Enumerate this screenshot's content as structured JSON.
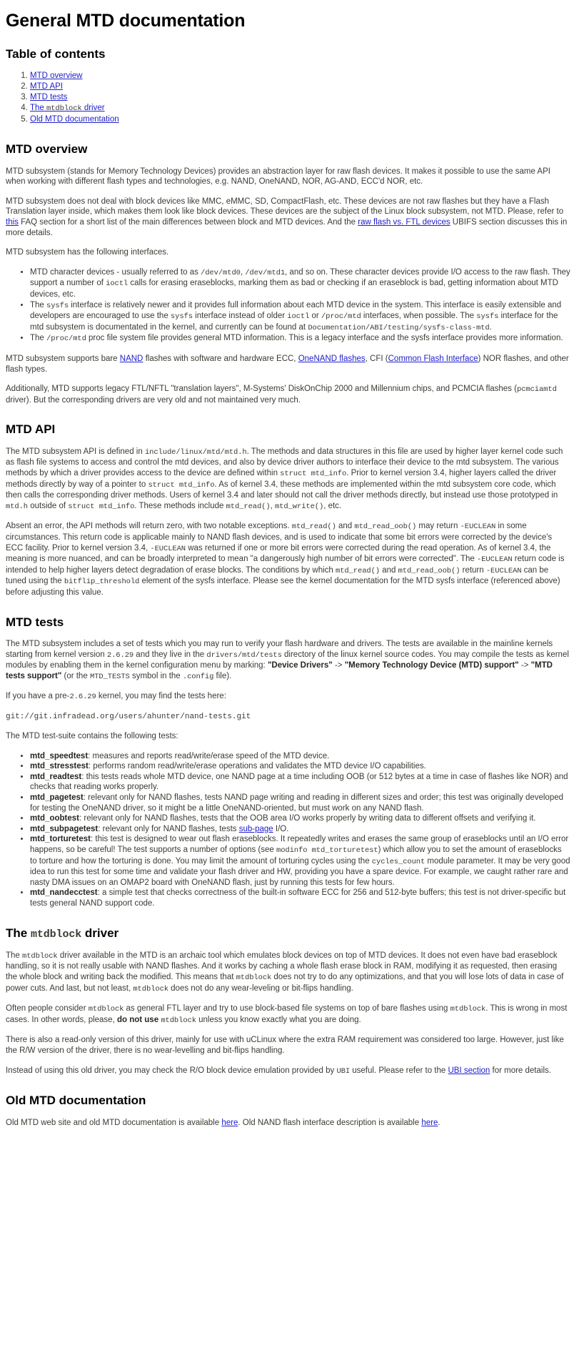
{
  "page": {
    "title": "General MTD documentation"
  },
  "toc": {
    "heading": "Table of contents",
    "items": [
      {
        "label": "MTD overview"
      },
      {
        "label": "MTD API"
      },
      {
        "label": "MTD tests"
      },
      {
        "label_pre": "The ",
        "label_code": "mtdblock",
        "label_post": " driver"
      },
      {
        "label": "Old MTD documentation"
      }
    ]
  },
  "overview": {
    "heading": "MTD overview",
    "p1": "MTD subsystem (stands for Memory Technology Devices) provides an abstraction layer for raw flash devices. It makes it possible to use the same API when working with different flash types and technologies, e.g. NAND, OneNAND, NOR, AG-AND, ECC'd NOR, etc.",
    "p2_a": "MTD subsystem does not deal with block devices like MMC, eMMC, SD, CompactFlash, etc. These devices are not raw flashes but they have a Flash Translation layer inside, which makes them look like block devices. These devices are the subject of the Linux block subsystem, not MTD. Please, refer to ",
    "p2_link1": "this",
    "p2_b": " FAQ section for a short list of the main differences between block and MTD devices. And the ",
    "p2_link2": "raw flash vs. FTL devices",
    "p2_c": " UBIFS section discusses this in more details.",
    "p3": "MTD subsystem has the following interfaces.",
    "bullet1_a": "MTD character devices - usually referred to as ",
    "bullet1_code1": "/dev/mtd0",
    "bullet1_b": ", ",
    "bullet1_code2": "/dev/mtd1",
    "bullet1_c": ", and so on. These character devices provide I/O access to the raw flash. They support a number of ",
    "bullet1_code3": "ioctl",
    "bullet1_d": " calls for erasing eraseblocks, marking them as bad or checking if an eraseblock is bad, getting information about MTD devices, etc.",
    "bullet2_a": "The ",
    "bullet2_code1": "sysfs",
    "bullet2_b": " interface is relatively newer and it provides full information about each MTD device in the system. This interface is easily extensible and developers are encouraged to use the ",
    "bullet2_code2": "sysfs",
    "bullet2_c": " interface instead of older ",
    "bullet2_code3": "ioctl",
    "bullet2_d": " or ",
    "bullet2_code4": "/proc/mtd",
    "bullet2_e": " interfaces, when possible. The ",
    "bullet2_code5": "sysfs",
    "bullet2_f": " interface for the mtd subsystem is documentated in the kernel, and currently can be found at ",
    "bullet2_code6": "Documentation/ABI/testing/sysfs-class-mtd",
    "bullet2_g": ".",
    "bullet3_a": "The ",
    "bullet3_code1": "/proc/mtd",
    "bullet3_b": " proc file system file provides general MTD information. This is a legacy interface and the sysfs interface provides more information.",
    "p4_a": "MTD subsystem supports bare ",
    "p4_link1": "NAND",
    "p4_b": " flashes with software and hardware ECC, ",
    "p4_link2": "OneNAND flashes",
    "p4_c": ", CFI (",
    "p4_link3": "Common Flash Interface",
    "p4_d": ") NOR flashes, and other flash types.",
    "p5_a": "Additionally, MTD supports legacy FTL/NFTL \"translation layers\", M-Systems' DiskOnChip 2000 and Millennium chips, and PCMCIA flashes (",
    "p5_code1": "pcmciamtd",
    "p5_b": " driver). But the corresponding drivers are very old and not maintained very much."
  },
  "api": {
    "heading": "MTD API",
    "p1_a": "The MTD subsystem API is defined in ",
    "p1_code1": "include/linux/mtd/mtd.h",
    "p1_b": ". The methods and data structures in this file are used by higher layer kernel code such as flash file systems to access and control the mtd devices, and also by device driver authors to interface their device to the mtd subsystem. The various methods by which a driver provides access to the device are defined within ",
    "p1_code2": "struct mtd_info",
    "p1_c": ". Prior to kernel version 3.4, higher layers called the driver methods directly by way of a pointer to ",
    "p1_code3": "struct mtd_info",
    "p1_d": ". As of kernel 3.4, these methods are implemented within the mtd subsystem core code, which then calls the corresponding driver methods. Users of kernel 3.4 and later should not call the driver methods directly, but instead use those prototyped in ",
    "p1_code4": "mtd.h",
    "p1_e": " outside of ",
    "p1_code5": "struct mtd_info",
    "p1_f": ". These methods include ",
    "p1_code6": "mtd_read()",
    "p1_g": ", ",
    "p1_code7": "mtd_write()",
    "p1_h": ", etc.",
    "p2_a": "Absent an error, the API methods will return zero, with two notable exceptions. ",
    "p2_code1": "mtd_read()",
    "p2_b": " and ",
    "p2_code2": "mtd_read_oob()",
    "p2_c": " may return ",
    "p2_code3": "-EUCLEAN",
    "p2_d": " in some circumstances. This return code is applicable mainly to NAND flash devices, and is used to indicate that some bit errors were corrected by the device's ECC facility. Prior to kernel version 3.4, ",
    "p2_code4": "-EUCLEAN",
    "p2_e": " was returned if one or more bit errors were corrected during the read operation. As of kernel 3.4, the meaning is more nuanced, and can be broadly interpreted to mean \"a dangerously high number of bit errors were corrected\". The ",
    "p2_code5": "-EUCLEAN",
    "p2_f": " return code is intended to help higher layers detect degradation of erase blocks. The conditions by which ",
    "p2_code6": "mtd_read()",
    "p2_g": " and ",
    "p2_code7": "mtd_read_oob()",
    "p2_h": " return ",
    "p2_code8": "-EUCLEAN",
    "p2_i": " can be tuned using the ",
    "p2_code9": "bitflip_threshold",
    "p2_j": " element of the sysfs interface. Please see the kernel documentation for the MTD sysfs interface (referenced above) before adjusting this value."
  },
  "tests": {
    "heading": "MTD tests",
    "p1_a": "The MTD subsystem includes a set of tests which you may run to verify your flash hardware and drivers. The tests are available in the mainline kernels starting from kernel version ",
    "p1_code1": "2.6.29",
    "p1_b": " and they live in the ",
    "p1_code2": "drivers/mtd/tests",
    "p1_c": " directory of the linux kernel source codes. You may compile the tests as kernel modules by enabling them in the kernel configuration menu by marking: ",
    "p1_bold1": "\"Device Drivers\"",
    "p1_d": " -> ",
    "p1_bold2": "\"Memory Technology Device (MTD) support\"",
    "p1_e": " -> ",
    "p1_bold3": "\"MTD tests support\"",
    "p1_f": " (or the ",
    "p1_code3": "MTD_TESTS",
    "p1_g": " symbol in the ",
    "p1_code4": ".config",
    "p1_h": " file).",
    "p2_a": "If you have a pre-",
    "p2_code1": "2.6.29",
    "p2_b": " kernel, you may find the tests here:",
    "code_block": "git://git.infradead.org/users/ahunter/nand-tests.git",
    "p3": "The MTD test-suite contains the following tests:",
    "items": [
      {
        "name": "mtd_speedtest",
        "desc": ": measures and reports read/write/erase speed of the MTD device."
      },
      {
        "name": "mtd_stresstest",
        "desc": ": performs random read/write/erase operations and validates the MTD device I/O capabilities."
      },
      {
        "name": "mtd_readtest",
        "desc": ": this tests reads whole MTD device, one NAND page at a time including OOB (or 512 bytes at a time in case of flashes like NOR) and checks that reading works properly."
      },
      {
        "name": "mtd_pagetest",
        "desc": ": relevant only for NAND flashes, tests NAND page writing and reading in different sizes and order; this test was originally developed for testing the OneNAND driver, so it might be a little OneNAND-oriented, but must work on any NAND flash."
      },
      {
        "name": "mtd_oobtest",
        "desc": ": relevant only for NAND flashes, tests that the OOB area I/O works properly by writing data to different offsets and verifying it."
      },
      {
        "name": "mtd_subpagetest",
        "desc_a": ": relevant only for NAND flashes, tests ",
        "link": "sub-page",
        "desc_b": " I/O."
      },
      {
        "name": "mtd_torturetest",
        "desc_a": ": this test is designed to wear out flash eraseblocks. It repeatedly writes and erases the same group of eraseblocks until an I/O error happens, so be careful! The test supports a number of options (see ",
        "code1": "modinfo mtd_torturetest",
        "desc_b": ") which allow you to set the amount of eraseblocks to torture and how the torturing is done. You may limit the amount of torturing cycles using the ",
        "code2": "cycles_count",
        "desc_c": " module parameter. It may be very good idea to run this test for some time and validate your flash driver and HW, providing you have a spare device. For example, we caught rather rare and nasty DMA issues on an OMAP2 board with OneNAND flash, just by running this tests for few hours."
      },
      {
        "name": "mtd_nandecctest",
        "desc": ": a simple test that checks correctness of the built-in software ECC for 256 and 512-byte buffers; this test is not driver-specific but tests general NAND support code."
      }
    ]
  },
  "mtdblock": {
    "heading_pre": "The ",
    "heading_code": "mtdblock",
    "heading_post": " driver",
    "p1_a": "The ",
    "p1_code1": "mtdblock",
    "p1_b": " driver available in the MTD is an archaic tool which emulates block devices on top of MTD devices. It does not even have bad eraseblock handling, so it is not really usable with NAND flashes. And it works by caching a whole flash erase block in RAM, modifying it as requested, then erasing the whole block and writing back the modified. This means that ",
    "p1_code2": "mtdblock",
    "p1_c": " does not try to do any optimizations, and that you will lose lots of data in case of power cuts. And last, but not least, ",
    "p1_code3": "mtdblock",
    "p1_d": " does not do any wear-leveling or bit-flips handling.",
    "p2_a": "Often people consider ",
    "p2_code1": "mtdblock",
    "p2_b": " as general FTL layer and try to use block-based file systems on top of bare flashes using ",
    "p2_code2": "mtdblock",
    "p2_c": ". This is wrong in most cases. In other words, please, ",
    "p2_bold": "do not use",
    "p2_d": " ",
    "p2_code3": "mtdblock",
    "p2_e": " unless you know exactly what you are doing.",
    "p3": "There is also a read-only version of this driver, mainly for use with uCLinux where the extra RAM requirement was considered too large. However, just like the R/W version of the driver, there is no wear-levelling and bit-flips handling.",
    "p4_a": "Instead of using this old driver, you may check the R/O block device emulation provided by ",
    "p4_code1": "UBI",
    "p4_b": " useful. Please refer to the ",
    "p4_link": "UBI section",
    "p4_c": " for more details."
  },
  "old_docs": {
    "heading": "Old MTD documentation",
    "p1_a": "Old MTD web site and old MTD documentation is available ",
    "p1_link1": "here",
    "p1_b": ". Old NAND flash interface description is available ",
    "p1_link2": "here",
    "p1_c": "."
  }
}
